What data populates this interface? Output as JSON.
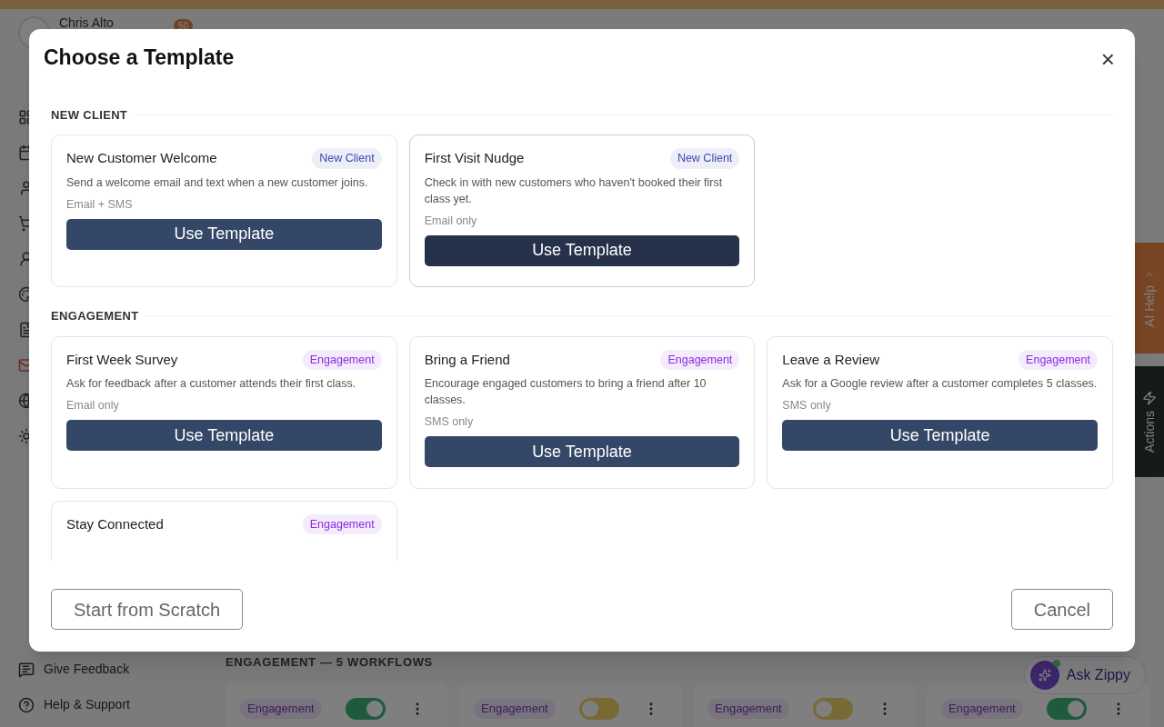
{
  "background": {
    "user_name": "Chris Alto",
    "notification_count": "50",
    "nav_icons": [
      {
        "selected": false
      },
      {
        "selected": false
      },
      {
        "selected": false
      },
      {
        "selected": false
      },
      {
        "selected": false
      },
      {
        "selected": false
      },
      {
        "selected": false
      },
      {
        "selected": true
      },
      {
        "selected": false
      },
      {
        "selected": false
      }
    ],
    "footer_links": [
      "Give Feedback",
      "Help & Support"
    ],
    "section_heading": "ENGAGEMENT — 5 WORKFLOWS",
    "workflows": [
      {
        "tag": "Engagement",
        "on": true
      },
      {
        "tag": "Engagement",
        "on": false
      },
      {
        "tag": "Engagement",
        "on": false
      },
      {
        "tag": "Engagement",
        "on": true
      }
    ],
    "side_tabs": [
      {
        "kind": "help",
        "label": "AI Help"
      },
      {
        "kind": "actions",
        "label": "Actions"
      }
    ],
    "assistant_button": {
      "label": "Ask Zippy",
      "online": true
    }
  },
  "dialog": {
    "title": "Choose a Template",
    "close": "×",
    "sections": [
      {
        "heading": "NEW CLIENT",
        "templates": [
          {
            "name": "New Customer Welcome",
            "tag": "New Client",
            "color": "#3b4bb0",
            "description": "Send a welcome email and text when a new customer joins.",
            "channels": "Email + SMS",
            "button": "Use Template",
            "highlighted": false
          },
          {
            "name": "First Visit Nudge",
            "tag": "New Client",
            "color": "#3b4bb0",
            "description": "Check in with new customers who haven't booked their first class yet.",
            "channels": "Email only",
            "button": "Use Template",
            "highlighted": true
          }
        ]
      },
      {
        "heading": "ENGAGEMENT",
        "templates": [
          {
            "name": "First Week Survey",
            "tag": "Engagement",
            "color": "#8a2be2",
            "description": "Ask for feedback after a customer attends their first class.",
            "channels": "Email only",
            "button": "Use Template",
            "highlighted": false
          },
          {
            "name": "Bring a Friend",
            "tag": "Engagement",
            "color": "#8a2be2",
            "description": "Encourage engaged customers to bring a friend after 10 classes.",
            "channels": "SMS only",
            "button": "Use Template",
            "highlighted": false
          },
          {
            "name": "Leave a Review",
            "tag": "Engagement",
            "color": "#8a2be2",
            "description": "Ask for a Google review after a customer completes 5 classes.",
            "channels": "SMS only",
            "button": "Use Template",
            "highlighted": false
          },
          {
            "name": "Stay Connected",
            "tag": "Engagement",
            "color": "#8a2be2"
          }
        ]
      }
    ],
    "secondary_button": "Start from Scratch",
    "cancel_button": "Cancel"
  }
}
